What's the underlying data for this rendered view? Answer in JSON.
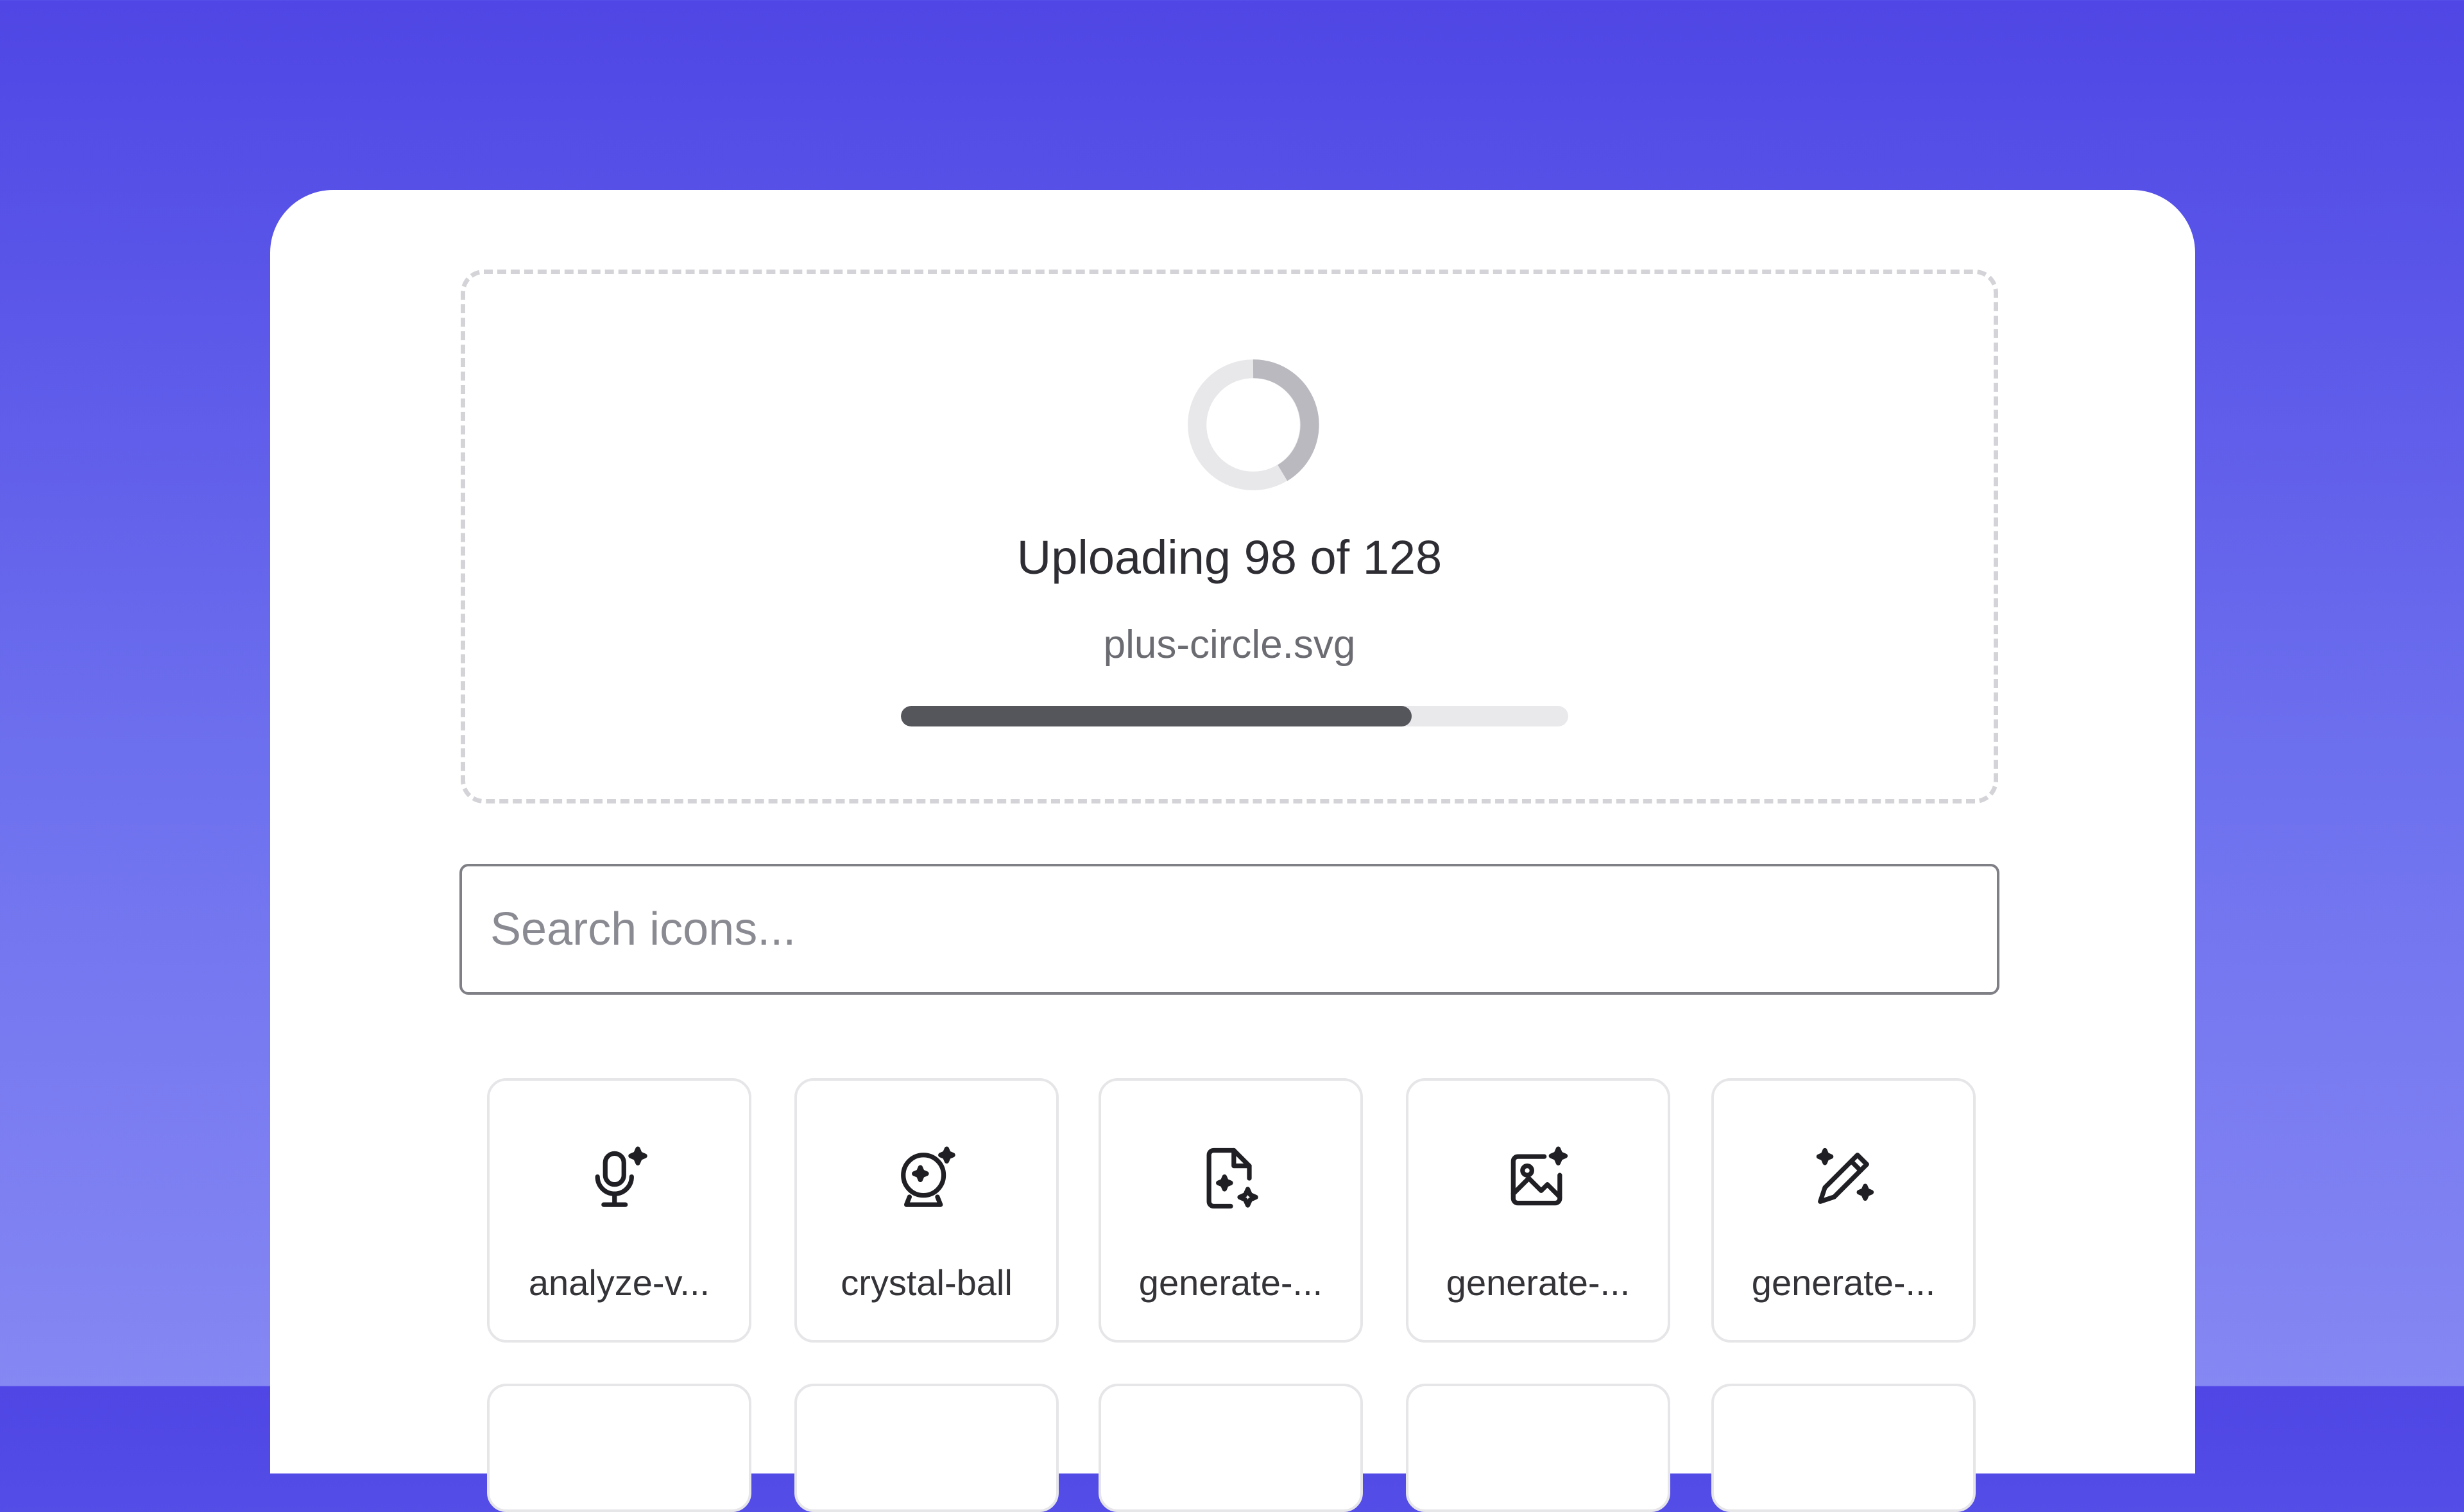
{
  "upload": {
    "title": "Uploading 98 of 128",
    "file_name": "plus-circle.svg",
    "progress_fraction": 0.765
  },
  "search": {
    "placeholder": "Search icons..."
  },
  "icons": [
    {
      "label": "analyze-v...",
      "icon": "microphone-sparkle-icon"
    },
    {
      "label": "crystal-ball",
      "icon": "crystal-ball-icon"
    },
    {
      "label": "generate-...",
      "icon": "file-sparkle-icon"
    },
    {
      "label": "generate-...",
      "icon": "image-sparkle-icon"
    },
    {
      "label": "generate-...",
      "icon": "pen-sparkle-icon"
    }
  ],
  "colors": {
    "accent": "#4f46e5",
    "progress_fill": "#55555c",
    "progress_track": "#e9e9ec"
  }
}
